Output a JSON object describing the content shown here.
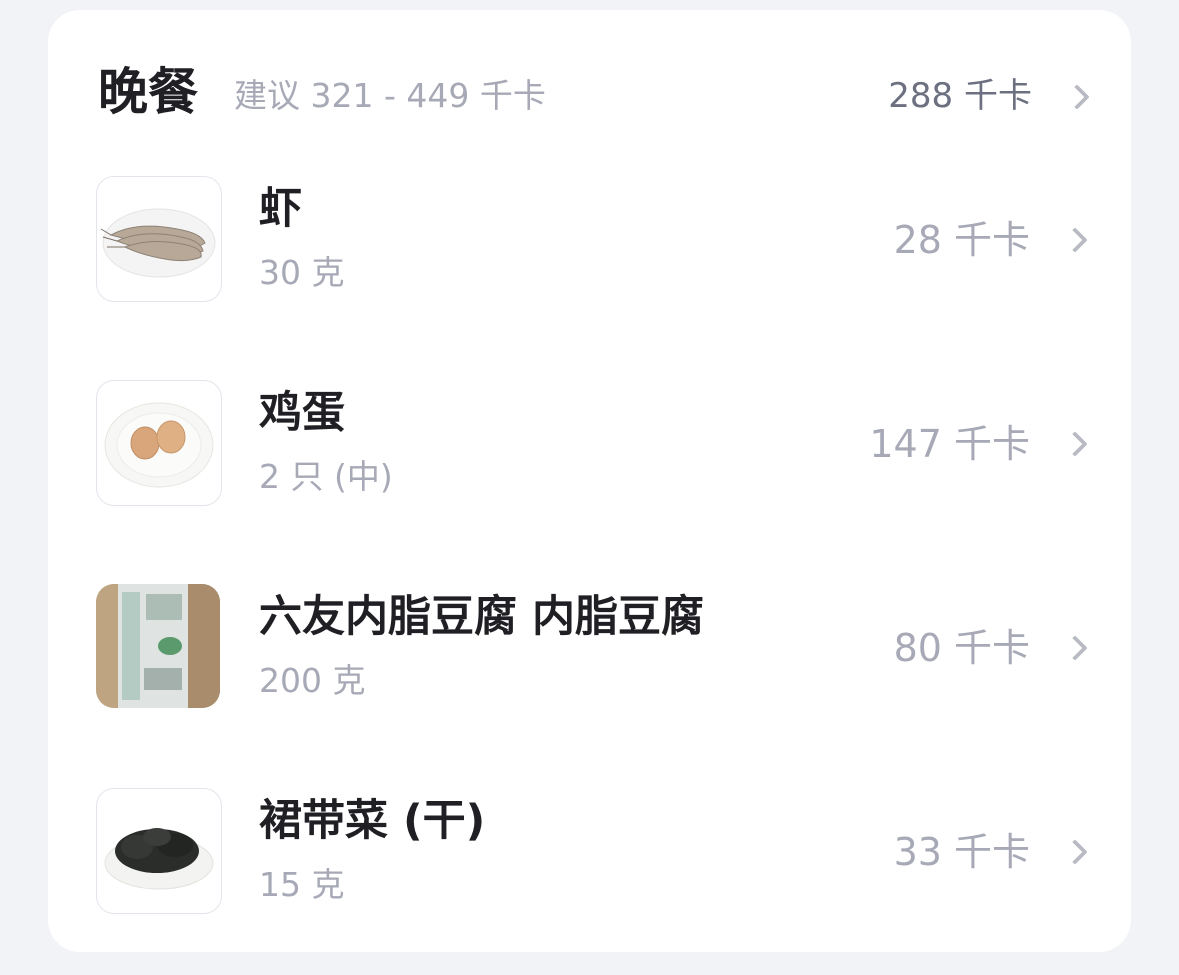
{
  "meal": {
    "title": "晚餐",
    "suggestion": "建议 321 - 449 千卡",
    "total": "288 千卡"
  },
  "items": [
    {
      "name": "虾",
      "amount": "30 克",
      "kcal": "28 千卡",
      "thumb_icon": "shrimp-plate"
    },
    {
      "name": "鸡蛋",
      "amount": "2 只 (中)",
      "kcal": "147 千卡",
      "thumb_icon": "eggs-plate"
    },
    {
      "name": "六友内脂豆腐 内脂豆腐",
      "amount": "200 克",
      "kcal": "80 千卡",
      "thumb_icon": "tofu-package"
    },
    {
      "name": "裙带菜 (干)",
      "amount": "15 克",
      "kcal": "33 千卡",
      "thumb_icon": "seaweed-plate"
    }
  ]
}
